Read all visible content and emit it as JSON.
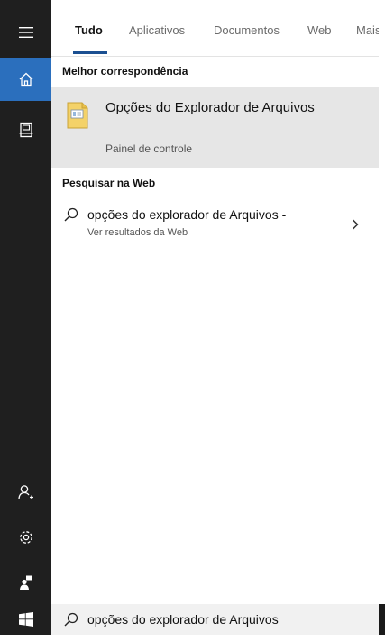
{
  "tabs": [
    {
      "label": "Tudo",
      "active": true
    },
    {
      "label": "Aplicativos",
      "active": false
    },
    {
      "label": "Documentos",
      "active": false
    },
    {
      "label": "Web",
      "active": false
    },
    {
      "label": "Mais",
      "active": false
    }
  ],
  "best_match": {
    "header": "Melhor correspondência",
    "title": "Opções do Explorador de Arquivos",
    "subtitle": "Painel de controle"
  },
  "web_search": {
    "header": "Pesquisar na Web",
    "query_text": "opções do explorador de Arquivos -",
    "subtitle": "Ver resultados da Web"
  },
  "search": {
    "value": "opções do explorador de Arquivos"
  },
  "rail": {
    "icons": [
      "hamburger-icon",
      "home-icon",
      "notebook-icon",
      "person-add-icon",
      "gear-icon",
      "feedback-icon",
      "windows-icon"
    ]
  },
  "colors": {
    "rail_bg": "#1f1f1f",
    "active_blue": "#2b6fbd",
    "selected_bg": "#e6e6e6",
    "tab_underline": "#1b4f91"
  }
}
